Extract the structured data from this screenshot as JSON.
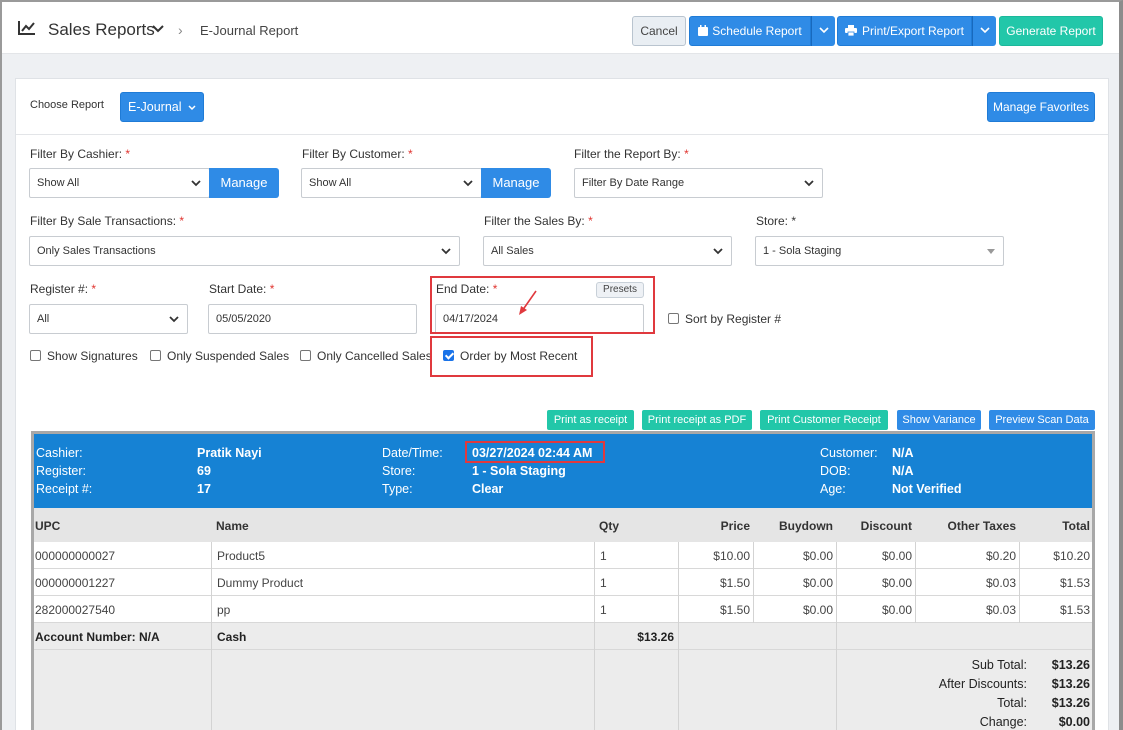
{
  "header": {
    "title": "Sales Reports",
    "breadcrumb": "E-Journal Report",
    "cancel": "Cancel",
    "schedule": "Schedule Report",
    "print_export": "Print/Export Report",
    "generate": "Generate Report"
  },
  "choose": {
    "label": "Choose Report",
    "value": "E-Journal",
    "favorites": "Manage Favorites"
  },
  "filters": {
    "cashier_label": "Filter By Cashier:",
    "cashier_value": "Show All",
    "customer_label": "Filter By Customer:",
    "customer_value": "Show All",
    "manage": "Manage",
    "report_by_label": "Filter the Report By:",
    "report_by_value": "Filter By Date Range",
    "sale_tx_label": "Filter By Sale Transactions:",
    "sale_tx_value": "Only Sales Transactions",
    "sales_by_label": "Filter the Sales By:",
    "sales_by_value": "All Sales",
    "store_label": "Store: *",
    "store_value": "1 - Sola Staging",
    "register_label": "Register #:",
    "register_value": "All",
    "start_label": "Start Date:",
    "start_value": "05/05/2020",
    "end_label": "End Date:",
    "end_value": "04/17/2024",
    "presets": "Presets",
    "sort_register": "Sort by Register #",
    "req": "*"
  },
  "checks": {
    "signatures": "Show Signatures",
    "suspended": "Only Suspended Sales",
    "cancelled": "Only Cancelled Sales",
    "most_recent": "Order by Most Recent"
  },
  "actions": {
    "print_receipt": "Print as receipt",
    "print_pdf": "Print receipt as PDF",
    "print_customer": "Print Customer Receipt",
    "variance": "Show Variance",
    "scan": "Preview Scan Data"
  },
  "receipt": {
    "cashier_label": "Cashier:",
    "cashier": "Pratik Nayi",
    "register_label": "Register:",
    "register": "69",
    "receipt_label": "Receipt #:",
    "receipt_no": "17",
    "datetime_label": "Date/Time:",
    "datetime": "03/27/2024 02:44 AM",
    "store_label": "Store:",
    "store": "1 - Sola Staging",
    "type_label": "Type:",
    "type": "Clear",
    "customer_label": "Customer:",
    "customer": "N/A",
    "dob_label": "DOB:",
    "dob": "N/A",
    "age_label": "Age:",
    "age": "Not Verified",
    "columns": [
      "UPC",
      "Name",
      "Qty",
      "Price",
      "Buydown",
      "Discount",
      "Other Taxes",
      "Total"
    ],
    "rows": [
      [
        "000000000027",
        "Product5",
        "1",
        "$10.00",
        "$0.00",
        "$0.00",
        "$0.20",
        "$10.20"
      ],
      [
        "000000001227",
        "Dummy Product",
        "1",
        "$1.50",
        "$0.00",
        "$0.00",
        "$0.03",
        "$1.53"
      ],
      [
        "282000027540",
        "pp",
        "1",
        "$1.50",
        "$0.00",
        "$0.00",
        "$0.03",
        "$1.53"
      ]
    ],
    "account": "Account Number: N/A",
    "tender": "Cash",
    "tender_amount": "$13.26",
    "sub_total_label": "Sub Total:",
    "sub_total": "$13.26",
    "after_disc_label": "After Discounts:",
    "after_disc": "$13.26",
    "total_label": "Total:",
    "total": "$13.26",
    "change_label": "Change:",
    "change": "$0.00"
  }
}
